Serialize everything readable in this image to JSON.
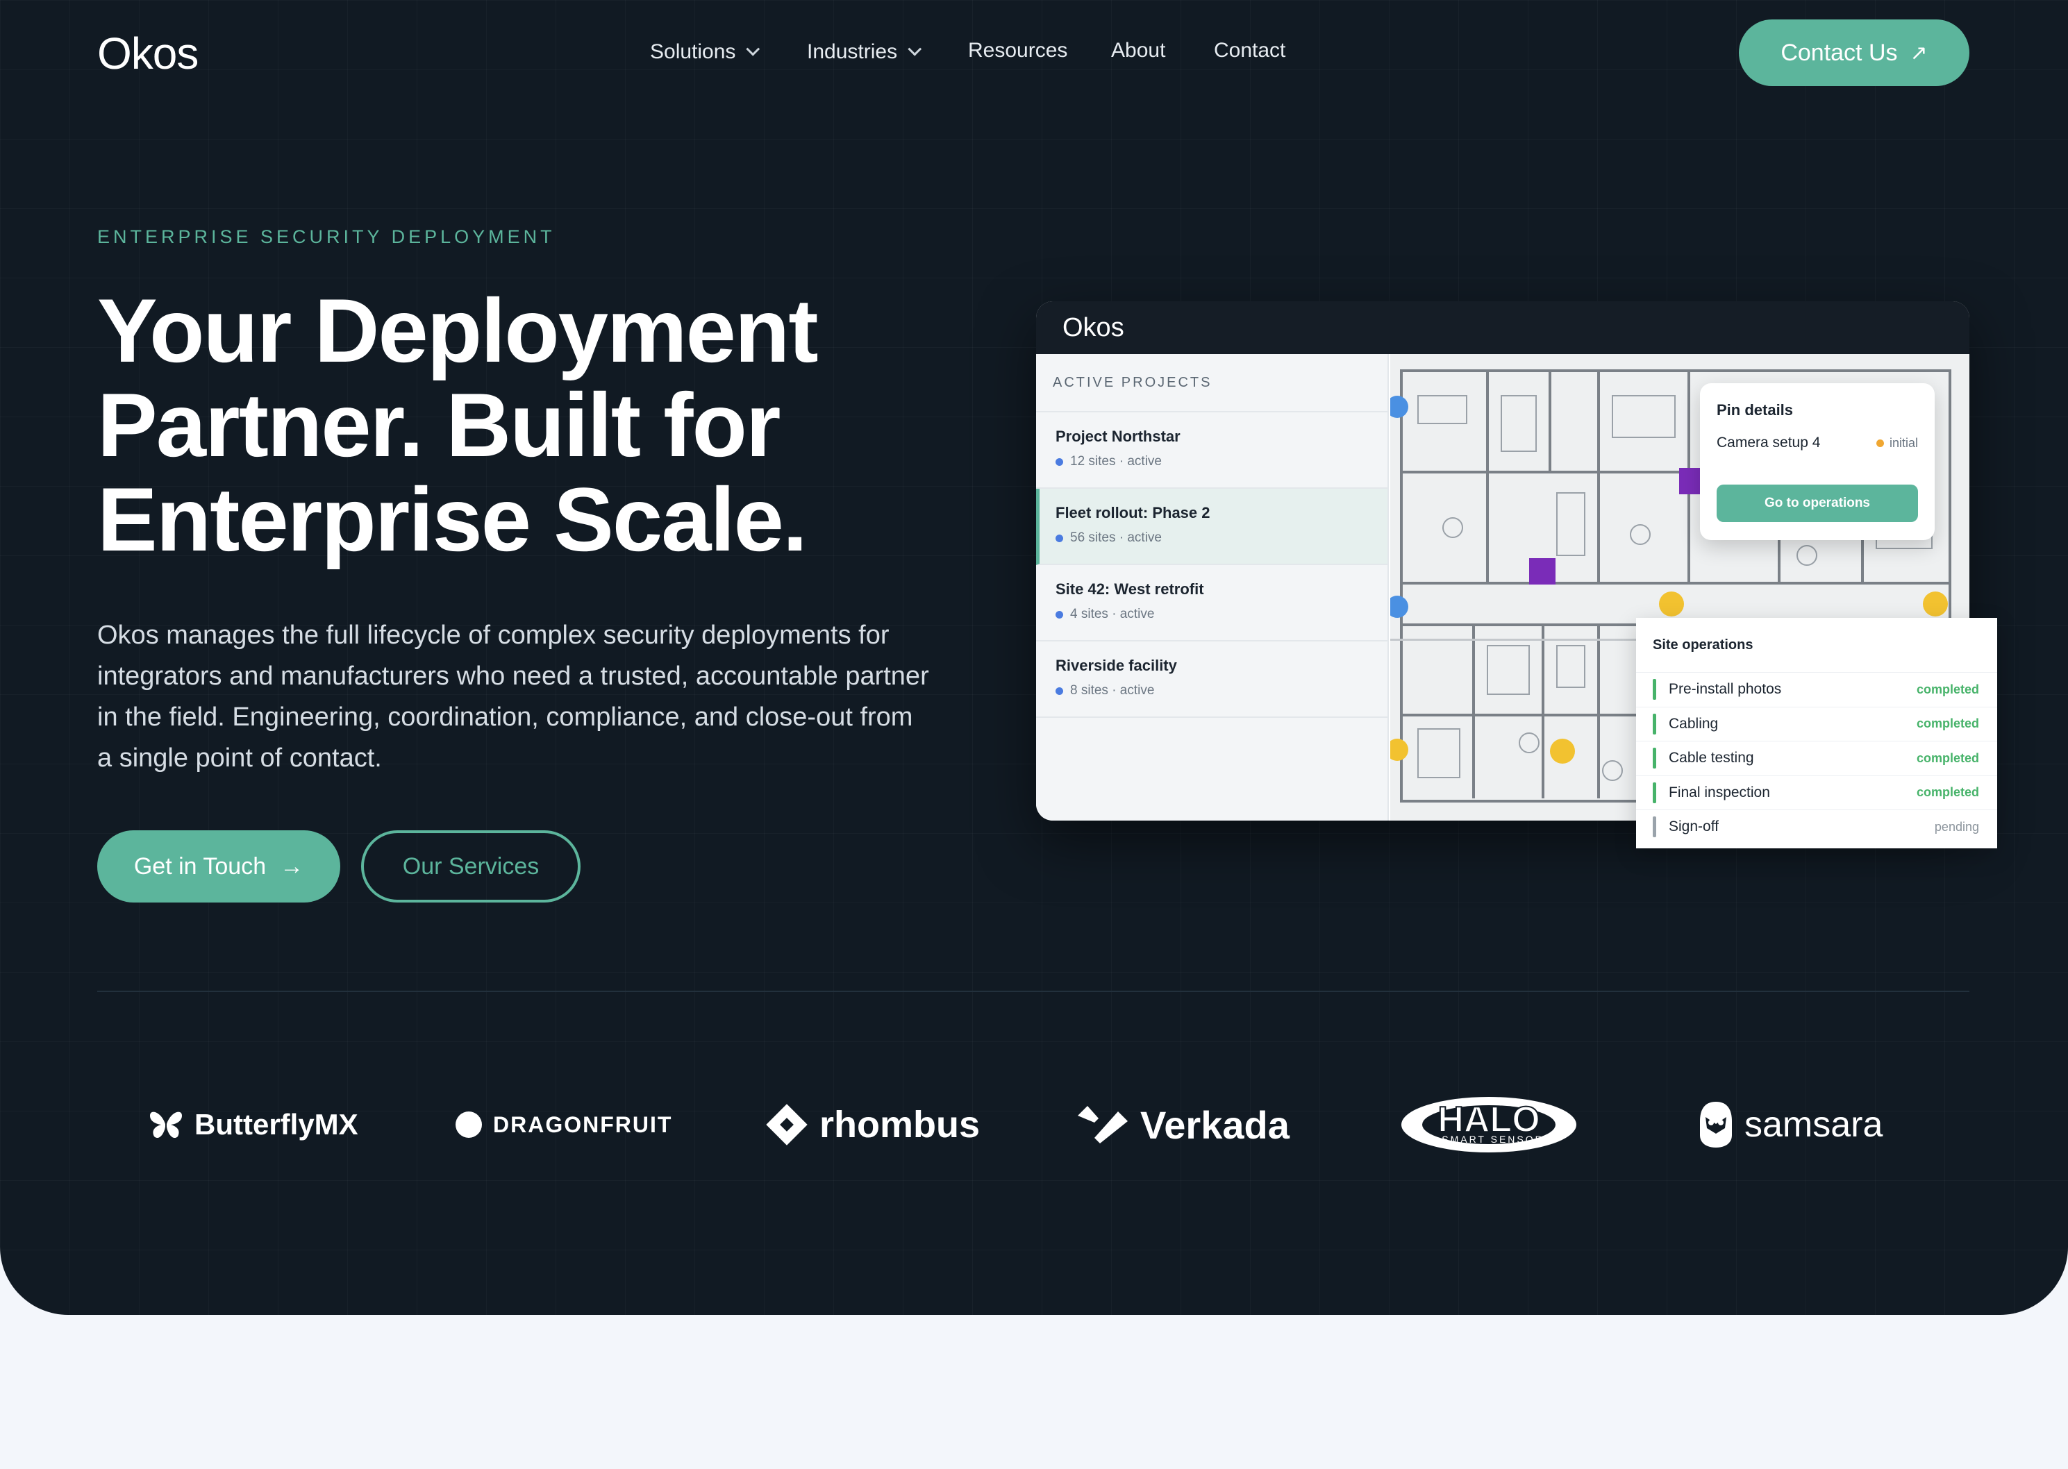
{
  "nav": {
    "logo": "Okos",
    "items": [
      {
        "label": "Solutions",
        "has_menu": true
      },
      {
        "label": "Industries",
        "has_menu": true
      },
      {
        "label": "Resources",
        "has_menu": false
      },
      {
        "label": "About",
        "has_menu": false
      },
      {
        "label": "Contact",
        "has_menu": false
      }
    ],
    "cta": "Contact Us"
  },
  "hero": {
    "eyebrow": "ENTERPRISE SECURITY DEPLOYMENT",
    "headline_lines": [
      "Your Deployment",
      "Partner. Built for",
      "Enterprise Scale."
    ],
    "lede": "Okos manages the full lifecycle of complex security deployments for integrators and manufacturers who need a trusted, accountable partner in the field. Engineering, coordination, compliance, and close-out from a single point of contact.",
    "primary_button": "Get in Touch",
    "secondary_button": "Our Services"
  },
  "app": {
    "title": "Okos",
    "sidebar_heading": "ACTIVE PROJECTS",
    "projects": [
      {
        "name": "Project Northstar",
        "meta": "12 sites · active"
      },
      {
        "name": "Fleet rollout: Phase 2",
        "meta": "56 sites · active"
      },
      {
        "name": "Site 42: West retrofit",
        "meta": "4 sites · active"
      },
      {
        "name": "Riverside facility",
        "meta": "8 sites · active"
      }
    ],
    "pin_card": {
      "title": "Pin details",
      "item": "Camera setup 4",
      "status": "initial",
      "button": "Go to operations"
    },
    "ops_card": {
      "title": "Site operations",
      "rows": [
        {
          "task": "Pre-install photos",
          "status": "completed"
        },
        {
          "task": "Cabling",
          "status": "completed"
        },
        {
          "task": "Cable testing",
          "status": "completed"
        },
        {
          "task": "Final inspection",
          "status": "completed"
        },
        {
          "task": "Sign-off",
          "status": "pending"
        }
      ]
    }
  },
  "partners": [
    "ButterflyMX",
    "DRAGONFRUIT",
    "rhombus",
    "Verkada",
    "HALO",
    "SMART SENSOR",
    "samsara"
  ],
  "colors": {
    "bg": "#111a23",
    "accent": "#5cb59c",
    "page": "#f3f6fb"
  }
}
